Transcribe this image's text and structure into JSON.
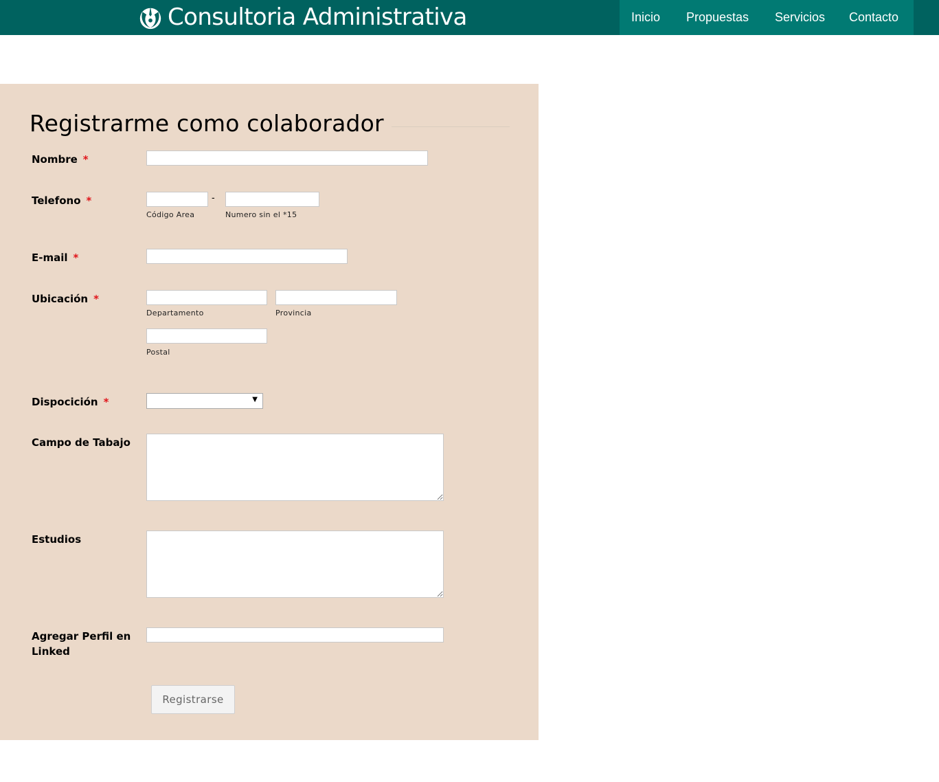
{
  "brand": {
    "title": "Consultoria Administrativa",
    "icon": "rebel-alliance-icon"
  },
  "nav": {
    "items": [
      {
        "label": "Inicio"
      },
      {
        "label": "Propuestas"
      },
      {
        "label": "Servicios"
      },
      {
        "label": "Contacto"
      }
    ]
  },
  "form": {
    "title": "Registrarme como colaborador",
    "required_mark": "*",
    "fields": {
      "nombre": {
        "label": "Nombre",
        "value": ""
      },
      "telefono": {
        "label": "Telefono",
        "separator": "-",
        "area_sub": "Código Area",
        "number_sub": "Numero sin el *15",
        "area_value": "",
        "number_value": ""
      },
      "email": {
        "label": "E-mail",
        "value": ""
      },
      "ubicacion": {
        "label": "Ubicación",
        "departamento_sub": "Departamento",
        "provincia_sub": "Provincia",
        "postal_sub": "Postal"
      },
      "disposicion": {
        "label": "Dispocición",
        "selected": ""
      },
      "campo": {
        "label": "Campo de Tabajo",
        "value": ""
      },
      "estudios": {
        "label": "Estudios",
        "value": ""
      },
      "linkedin": {
        "label_line1": "Agregar Perfil en",
        "label_line2": "Linked",
        "value": ""
      }
    },
    "submit_label": "Registrarse"
  },
  "colors": {
    "navbar": "#00625f",
    "nav_active_bg": "#017a73",
    "panel": "#ebd9c9",
    "required": "#e0161b"
  }
}
